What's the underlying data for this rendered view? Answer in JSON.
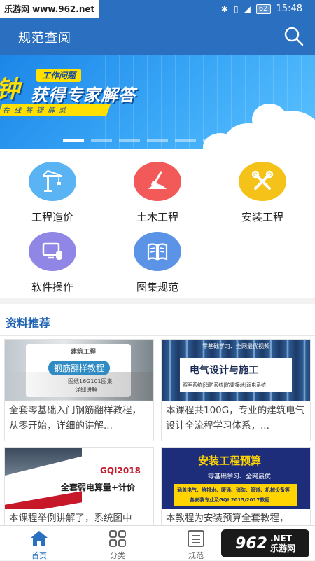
{
  "status_bar": {
    "watermark": "乐游网 www.962.net",
    "battery": "62",
    "time": "15:48"
  },
  "header": {
    "title": "规范查阅",
    "search_icon": "search-icon"
  },
  "banner": {
    "big_text": "钟",
    "tag": "工作问题",
    "main": "获得专家解答",
    "sub": "在线答疑解惑",
    "active_dot": 0,
    "dot_count": 7
  },
  "categories": [
    {
      "label": "工程造价",
      "icon": "crane-icon",
      "color": "#5ab3f3"
    },
    {
      "label": "土木工程",
      "icon": "shovel-icon",
      "color": "#f25a5a"
    },
    {
      "label": "安装工程",
      "icon": "tools-icon",
      "color": "#f5c219"
    },
    {
      "label": "软件操作",
      "icon": "monitor-icon",
      "color": "#8f86e6"
    },
    {
      "label": "图集规范",
      "icon": "book-icon",
      "color": "#5b93e6"
    }
  ],
  "section": {
    "title": "资料推荐"
  },
  "cards": [
    {
      "text": "全套零基础入门钢筋翻样教程，从零开始，详细的讲解...",
      "thumb": {
        "tag": "建筑工程",
        "title": "钢筋翻样教程",
        "note1": "图纸16G101图集",
        "note2": "详细讲解"
      }
    },
    {
      "text": "本课程共100G，专业的建筑电气设计全流程学习体系，...",
      "thumb": {
        "top": "零基础学习、全网最优视频",
        "title": "电气设计与施工",
        "note": "照明系统|消防系统|防雷接地|弱电系统"
      }
    },
    {
      "text": "本课程举例讲解了，系统图中",
      "thumb": {
        "code": "GQI2018",
        "title": "全套弱电算量+计价"
      }
    },
    {
      "text": "本教程为安装预算全套教程，",
      "thumb": {
        "title": "安装工程预算",
        "sub": "零基础学习、全网最优",
        "note1": "涵盖电气、给排水、暖通、消防、管道、机械设备等",
        "note2": "各安装专业及GQI 2015/2017教程"
      }
    }
  ],
  "nav": {
    "items": [
      {
        "label": "首页",
        "icon": "home-icon"
      },
      {
        "label": "分类",
        "icon": "grid-icon"
      },
      {
        "label": "规范",
        "icon": "list-icon"
      },
      {
        "label": "",
        "icon": ""
      }
    ],
    "active": 0,
    "badge_num": "962",
    "badge_text": "乐游网",
    "badge_net": ".NET"
  },
  "colors": {
    "primary": "#2a6fc0",
    "section_title": "#1f63b3"
  }
}
